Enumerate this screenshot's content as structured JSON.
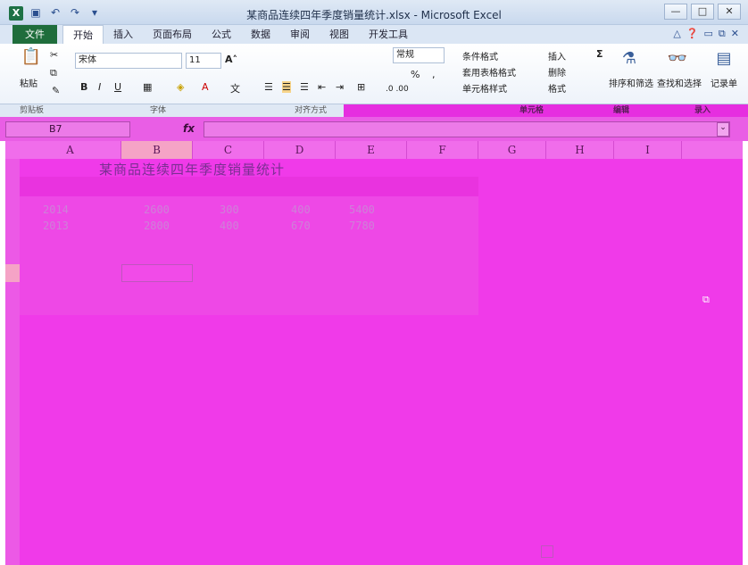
{
  "window": {
    "title": "某商品连续四年季度销量统计.xlsx - Microsoft Excel",
    "app_icon": "X",
    "controls": [
      "—",
      "□",
      "✕"
    ]
  },
  "quick_access": [
    "save-icon",
    "undo-icon",
    "redo-icon",
    "customize-icon"
  ],
  "tabs": {
    "file": "文件",
    "items": [
      "开始",
      "插入",
      "页面布局",
      "公式",
      "数据",
      "审阅",
      "视图",
      "开发工具"
    ],
    "active": "开始"
  },
  "ribbon": {
    "paste_label": "粘贴",
    "font_name": "宋体",
    "font_size": "11",
    "bold": "B",
    "italic": "I",
    "underline": "U",
    "number_format": "常规",
    "percent": "%",
    "comma": ",",
    "cond_format": "条件格式",
    "table_format": "套用表格格式",
    "cell_style": "单元格样式",
    "insert": "插入",
    "delete": "删除",
    "format": "格式",
    "sigma": "Σ",
    "sort_filter": "排序和筛选",
    "find_select": "查找和选择",
    "record": "记录单"
  },
  "groups": {
    "clipboard": "剪贴板",
    "font": "字体",
    "align": "对齐方式",
    "cells": "单元格",
    "edit": "编辑",
    "record": "录入"
  },
  "formula_bar": {
    "name_box": "B7",
    "fx": "fx",
    "formula": ""
  },
  "sheet": {
    "columns": [
      "A",
      "B",
      "C",
      "D",
      "E",
      "F",
      "G",
      "H",
      "I"
    ],
    "selected_column": "B",
    "title": "某商品连续四年季度销量统计",
    "rows": [
      [
        "2014",
        "2600",
        "300",
        "400",
        "5400"
      ],
      [
        "2013",
        "2800",
        "400",
        "670",
        "7780"
      ]
    ]
  },
  "colors": {
    "file_tab": "#1f6d3c",
    "overlay": "#f03ae9"
  }
}
